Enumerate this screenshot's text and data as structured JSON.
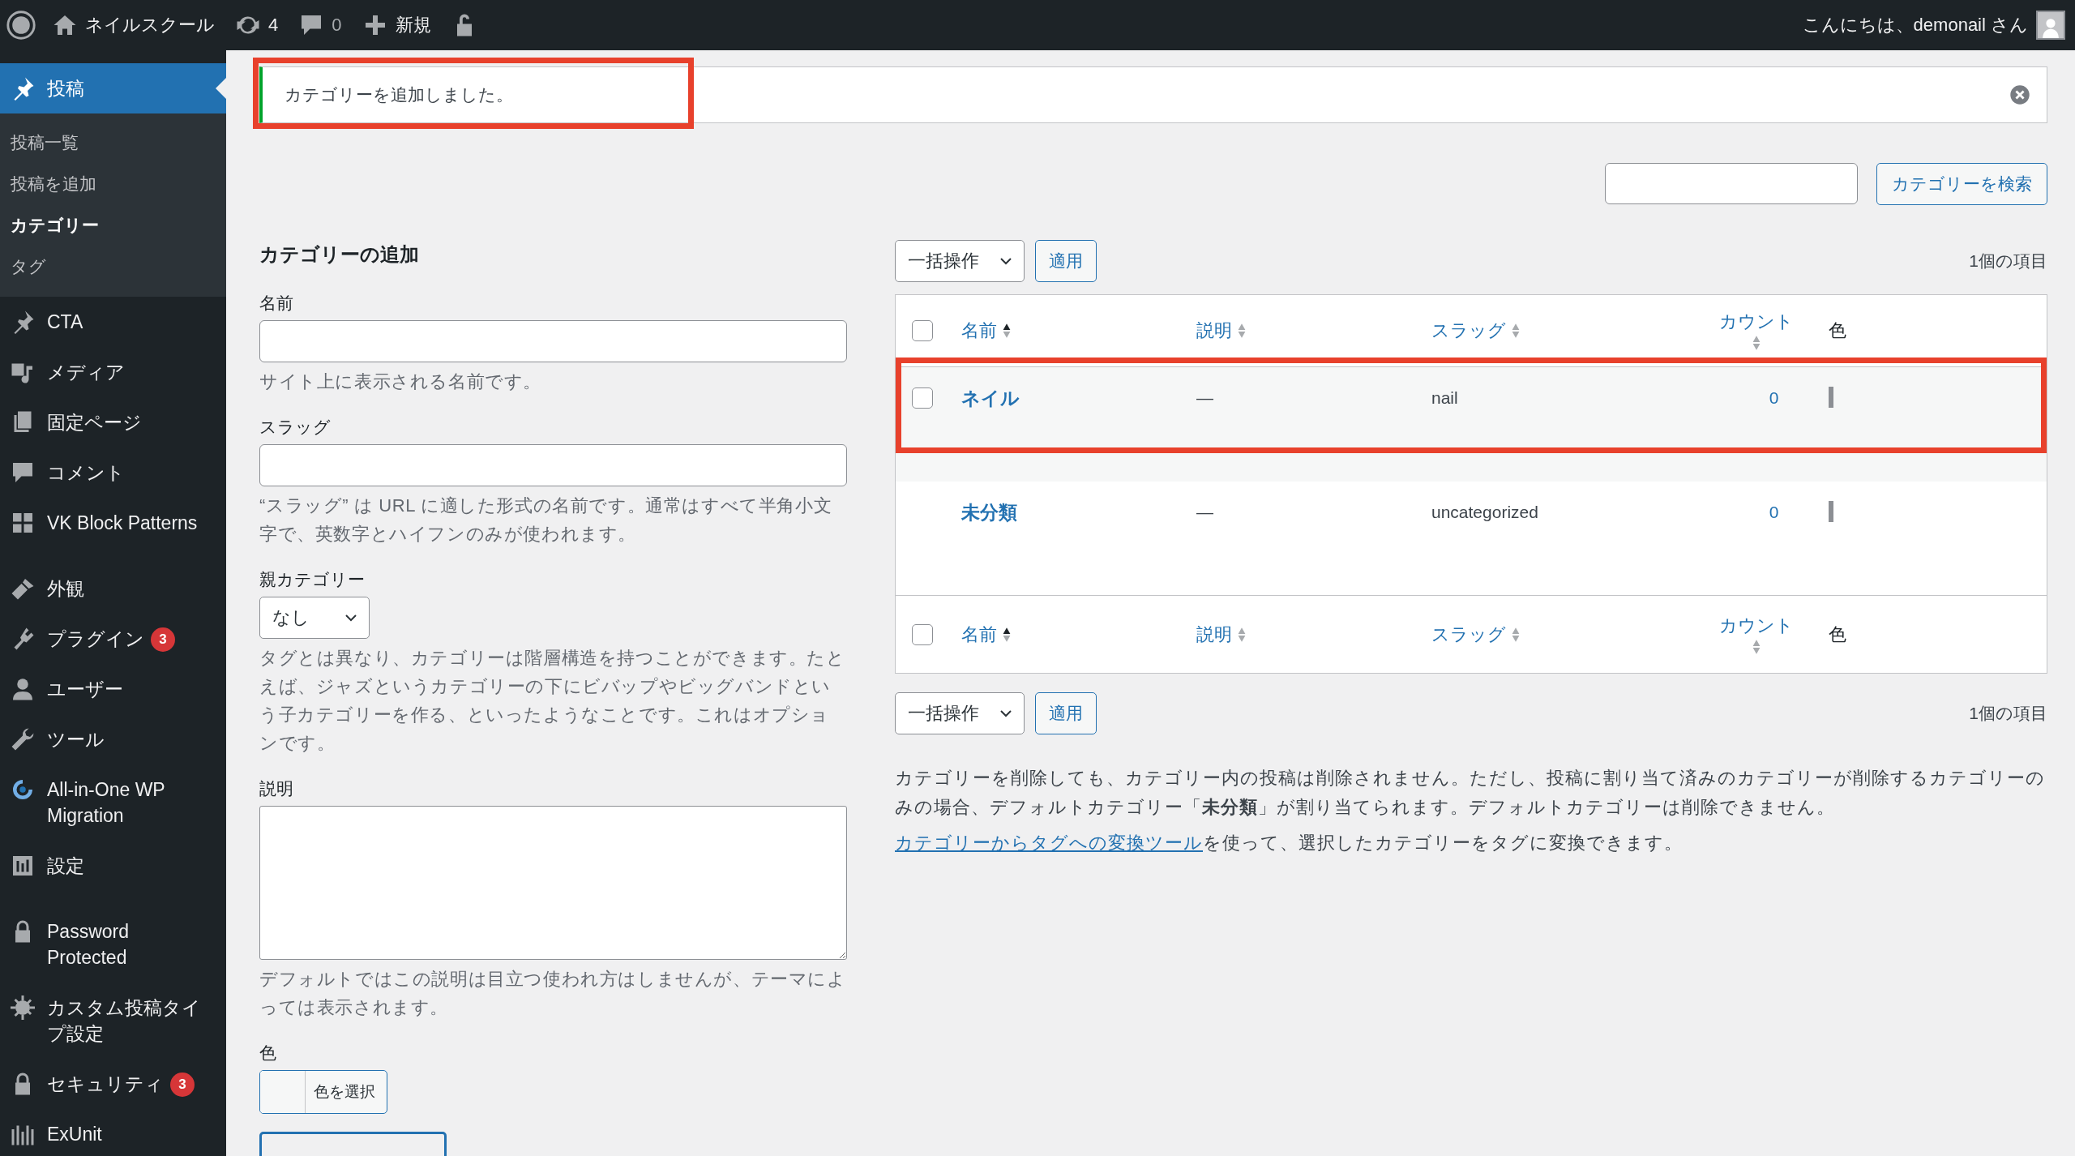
{
  "admin_bar": {
    "site_name": "ネイルスクール",
    "updates": "4",
    "comments": "0",
    "new": "新規",
    "greeting": "こんにちは、demonail さん"
  },
  "sidebar": {
    "items": [
      {
        "label": "投稿",
        "selected": true,
        "children": [
          {
            "label": "投稿一覧",
            "selected": false
          },
          {
            "label": "投稿を追加",
            "selected": false
          },
          {
            "label": "カテゴリー",
            "selected": true
          },
          {
            "label": "タグ",
            "selected": false
          }
        ]
      },
      {
        "label": "CTA",
        "selected": false
      },
      {
        "label": "メディア",
        "selected": false
      },
      {
        "label": "固定ページ",
        "selected": false
      },
      {
        "label": "コメント",
        "selected": false
      },
      {
        "label": "VK Block Patterns",
        "selected": false
      },
      {
        "label": "外観",
        "selected": false
      },
      {
        "label": "プラグイン",
        "selected": false,
        "badge": "3"
      },
      {
        "label": "ユーザー",
        "selected": false
      },
      {
        "label": "ツール",
        "selected": false
      },
      {
        "label": "All-in-One WP Migration",
        "selected": false
      },
      {
        "label": "設定",
        "selected": false
      },
      {
        "label": "Password Protected",
        "selected": false
      },
      {
        "label": "カスタム投稿タイプ設定",
        "selected": false
      },
      {
        "label": "セキュリティ",
        "selected": false,
        "badge": "3"
      },
      {
        "label": "ExUnit",
        "selected": false
      }
    ]
  },
  "notice": {
    "message": "カテゴリーを追加しました。",
    "highlighted": true
  },
  "search": {
    "button": "カテゴリーを検索"
  },
  "add_form": {
    "title": "カテゴリーの追加",
    "fields": [
      {
        "kind": "text",
        "label": "名前",
        "help": "サイト上に表示される名前です。"
      },
      {
        "kind": "text",
        "label": "スラッグ",
        "help": "“スラッグ” は URL に適した形式の名前です。通常はすべて半角小文字で、英数字とハイフンのみが使われます。"
      },
      {
        "kind": "select",
        "label": "親カテゴリー",
        "value": "なし",
        "help": "タグとは異なり、カテゴリーは階層構造を持つことができます。たとえば、ジャズというカテゴリーの下にビバップやビッグバンドという子カテゴリーを作る、といったようなことです。これはオプションです。"
      },
      {
        "kind": "textarea",
        "label": "説明",
        "help": "デフォルトではこの説明は目立つ使われ方はしませんが、テーマによっては表示されます。"
      },
      {
        "kind": "color",
        "label": "色",
        "button": "色を選択"
      }
    ]
  },
  "top_nav": {
    "bulk_action": "一括操作",
    "apply": "適用",
    "count": "1個の項目"
  },
  "table": {
    "header_checked": false,
    "footer_checked": false,
    "columns": [
      {
        "label": "名前",
        "sorted": true
      },
      {
        "label": "説明",
        "sorted": false
      },
      {
        "label": "スラッグ",
        "sorted": false
      },
      {
        "label": "カウント",
        "sorted": false
      },
      {
        "label": "色"
      }
    ],
    "rows": [
      {
        "kind": "selectable",
        "checked": false,
        "highlighted": true,
        "name": "ネイル",
        "description": "—",
        "slug": "nail",
        "count": "0"
      },
      {
        "kind": "default",
        "highlighted": false,
        "name": "未分類",
        "description": "—",
        "slug": "uncategorized",
        "count": "0"
      }
    ],
    "footer_columns": [
      {
        "label": "名前",
        "sorted": true
      },
      {
        "label": "説明",
        "sorted": false
      },
      {
        "label": "スラッグ",
        "sorted": false
      },
      {
        "label": "カウント",
        "sorted": false
      },
      {
        "label": "色"
      }
    ]
  },
  "bottom_nav": {
    "bulk_action": "一括操作",
    "apply": "適用",
    "count": "1個の項目"
  },
  "notes": {
    "text": "カテゴリーを削除しても、カテゴリー内の投稿は削除されません。ただし、投稿に割り当て済みのカテゴリーが削除するカテゴリーのみの場合、デフォルトカテゴリー「**未分類**」が割り当てられます。デフォルトカテゴリーは削除できません。",
    "link": "カテゴリーからタグへの変換ツール",
    "link_suffix": "を使って、選択したカテゴリーをタグに変換できます。"
  }
}
